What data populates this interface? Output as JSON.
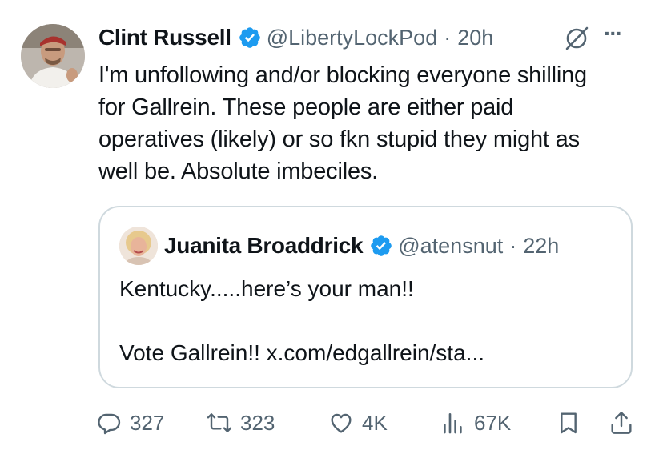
{
  "tweet": {
    "author_name": "Clint Russell",
    "handle": "@LibertyLockPod",
    "separator": "·",
    "time": "20h",
    "more_label": "···",
    "text": "I'm unfollowing and/or blocking everyone shilling\nfor Gallrein. These people are either paid\noperatives (likely) or so fkn stupid they might as\nwell be. Absolute imbeciles."
  },
  "quote": {
    "author_name": "Juanita Broaddrick",
    "handle": "@atensnut",
    "separator": "·",
    "time": "22h",
    "text": "Kentucky.....here’s your man!!\n\nVote Gallrein!! x.com/edgallrein/sta..."
  },
  "actions": {
    "replies": "327",
    "reposts": "323",
    "likes": "4K",
    "views": "67K"
  },
  "colors": {
    "verified": "#1d9bf0",
    "muted": "#536471",
    "border": "#cfd9de"
  },
  "icons": [
    "verified-badge-icon",
    "grok-icon",
    "more-icon",
    "reply-icon",
    "repost-icon",
    "like-icon",
    "views-icon",
    "bookmark-icon",
    "share-icon"
  ]
}
